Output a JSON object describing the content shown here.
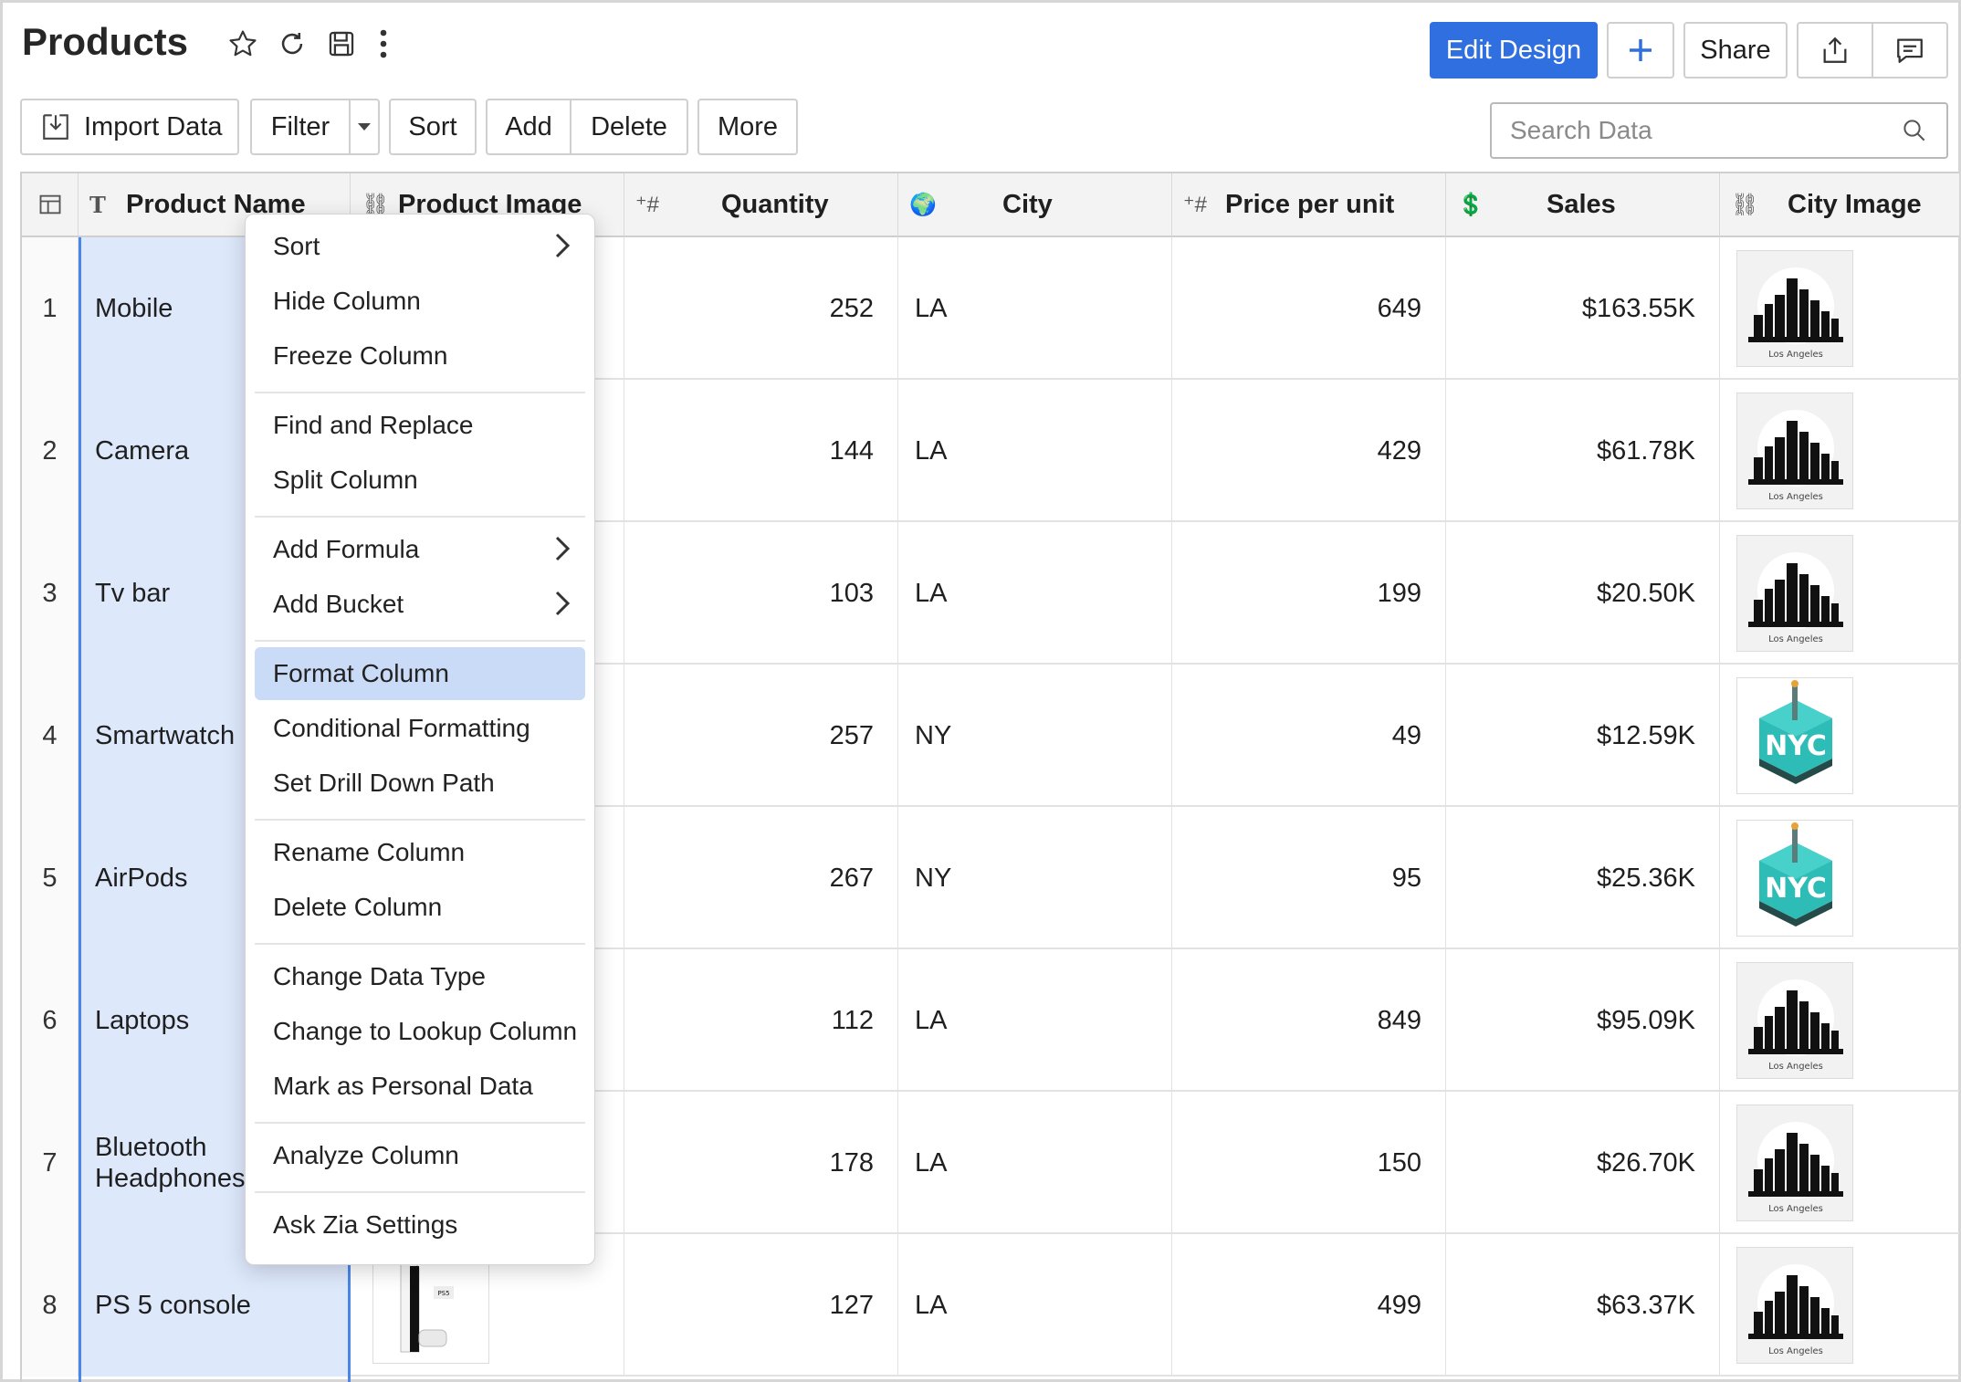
{
  "header": {
    "title": "Products",
    "edit_design": "Edit Design",
    "share": "Share"
  },
  "toolbar": {
    "import_data": "Import Data",
    "filter": "Filter",
    "sort": "Sort",
    "add": "Add",
    "delete": "Delete",
    "more": "More",
    "search_placeholder": "Search Data"
  },
  "columns": {
    "product_name": "Product Name",
    "product_image": "Product Image",
    "quantity": "Quantity",
    "city": "City",
    "price_per_unit": "Price per unit",
    "sales": "Sales",
    "city_image": "City Image"
  },
  "rows": [
    {
      "idx": "1",
      "name": "Mobile",
      "quantity": "252",
      "city": "LA",
      "price": "649",
      "sales": "$163.55K",
      "city_image": "Los Angeles"
    },
    {
      "idx": "2",
      "name": "Camera",
      "quantity": "144",
      "city": "LA",
      "price": "429",
      "sales": "$61.78K",
      "city_image": "Los Angeles"
    },
    {
      "idx": "3",
      "name": "Tv bar",
      "quantity": "103",
      "city": "LA",
      "price": "199",
      "sales": "$20.50K",
      "city_image": "Los Angeles"
    },
    {
      "idx": "4",
      "name": "Smartwatch",
      "quantity": "257",
      "city": "NY",
      "price": "49",
      "sales": "$12.59K",
      "city_image": "NYC"
    },
    {
      "idx": "5",
      "name": "AirPods",
      "quantity": "267",
      "city": "NY",
      "price": "95",
      "sales": "$25.36K",
      "city_image": "NYC"
    },
    {
      "idx": "6",
      "name": "Laptops",
      "quantity": "112",
      "city": "LA",
      "price": "849",
      "sales": "$95.09K",
      "city_image": "Los Angeles"
    },
    {
      "idx": "7",
      "name": "Bluetooth\nHeadphones",
      "quantity": "178",
      "city": "LA",
      "price": "150",
      "sales": "$26.70K",
      "city_image": "Los Angeles"
    },
    {
      "idx": "8",
      "name": "PS 5 console",
      "quantity": "127",
      "city": "LA",
      "price": "499",
      "sales": "$63.37K",
      "city_image": "Los Angeles"
    }
  ],
  "context_menu": {
    "items": [
      {
        "label": "Sort",
        "has_submenu": true
      },
      {
        "label": "Hide Column"
      },
      {
        "label": "Freeze Column"
      },
      {
        "label": "Find and Replace"
      },
      {
        "label": "Split Column"
      },
      {
        "label": "Add Formula",
        "has_submenu": true
      },
      {
        "label": "Add Bucket",
        "has_submenu": true
      },
      {
        "label": "Format Column",
        "active": true
      },
      {
        "label": "Conditional Formatting"
      },
      {
        "label": "Set Drill Down Path"
      },
      {
        "label": "Rename Column"
      },
      {
        "label": "Delete Column"
      },
      {
        "label": "Change Data Type"
      },
      {
        "label": "Change to Lookup Column"
      },
      {
        "label": "Mark as Personal Data"
      },
      {
        "label": "Analyze Column"
      },
      {
        "label": "Ask Zia Settings"
      }
    ]
  },
  "colors": {
    "primary": "#2f6fe0",
    "selection_fill": "#dde8fb",
    "selection_border": "#4a86e8",
    "menu_active": "#c9dbf7"
  }
}
